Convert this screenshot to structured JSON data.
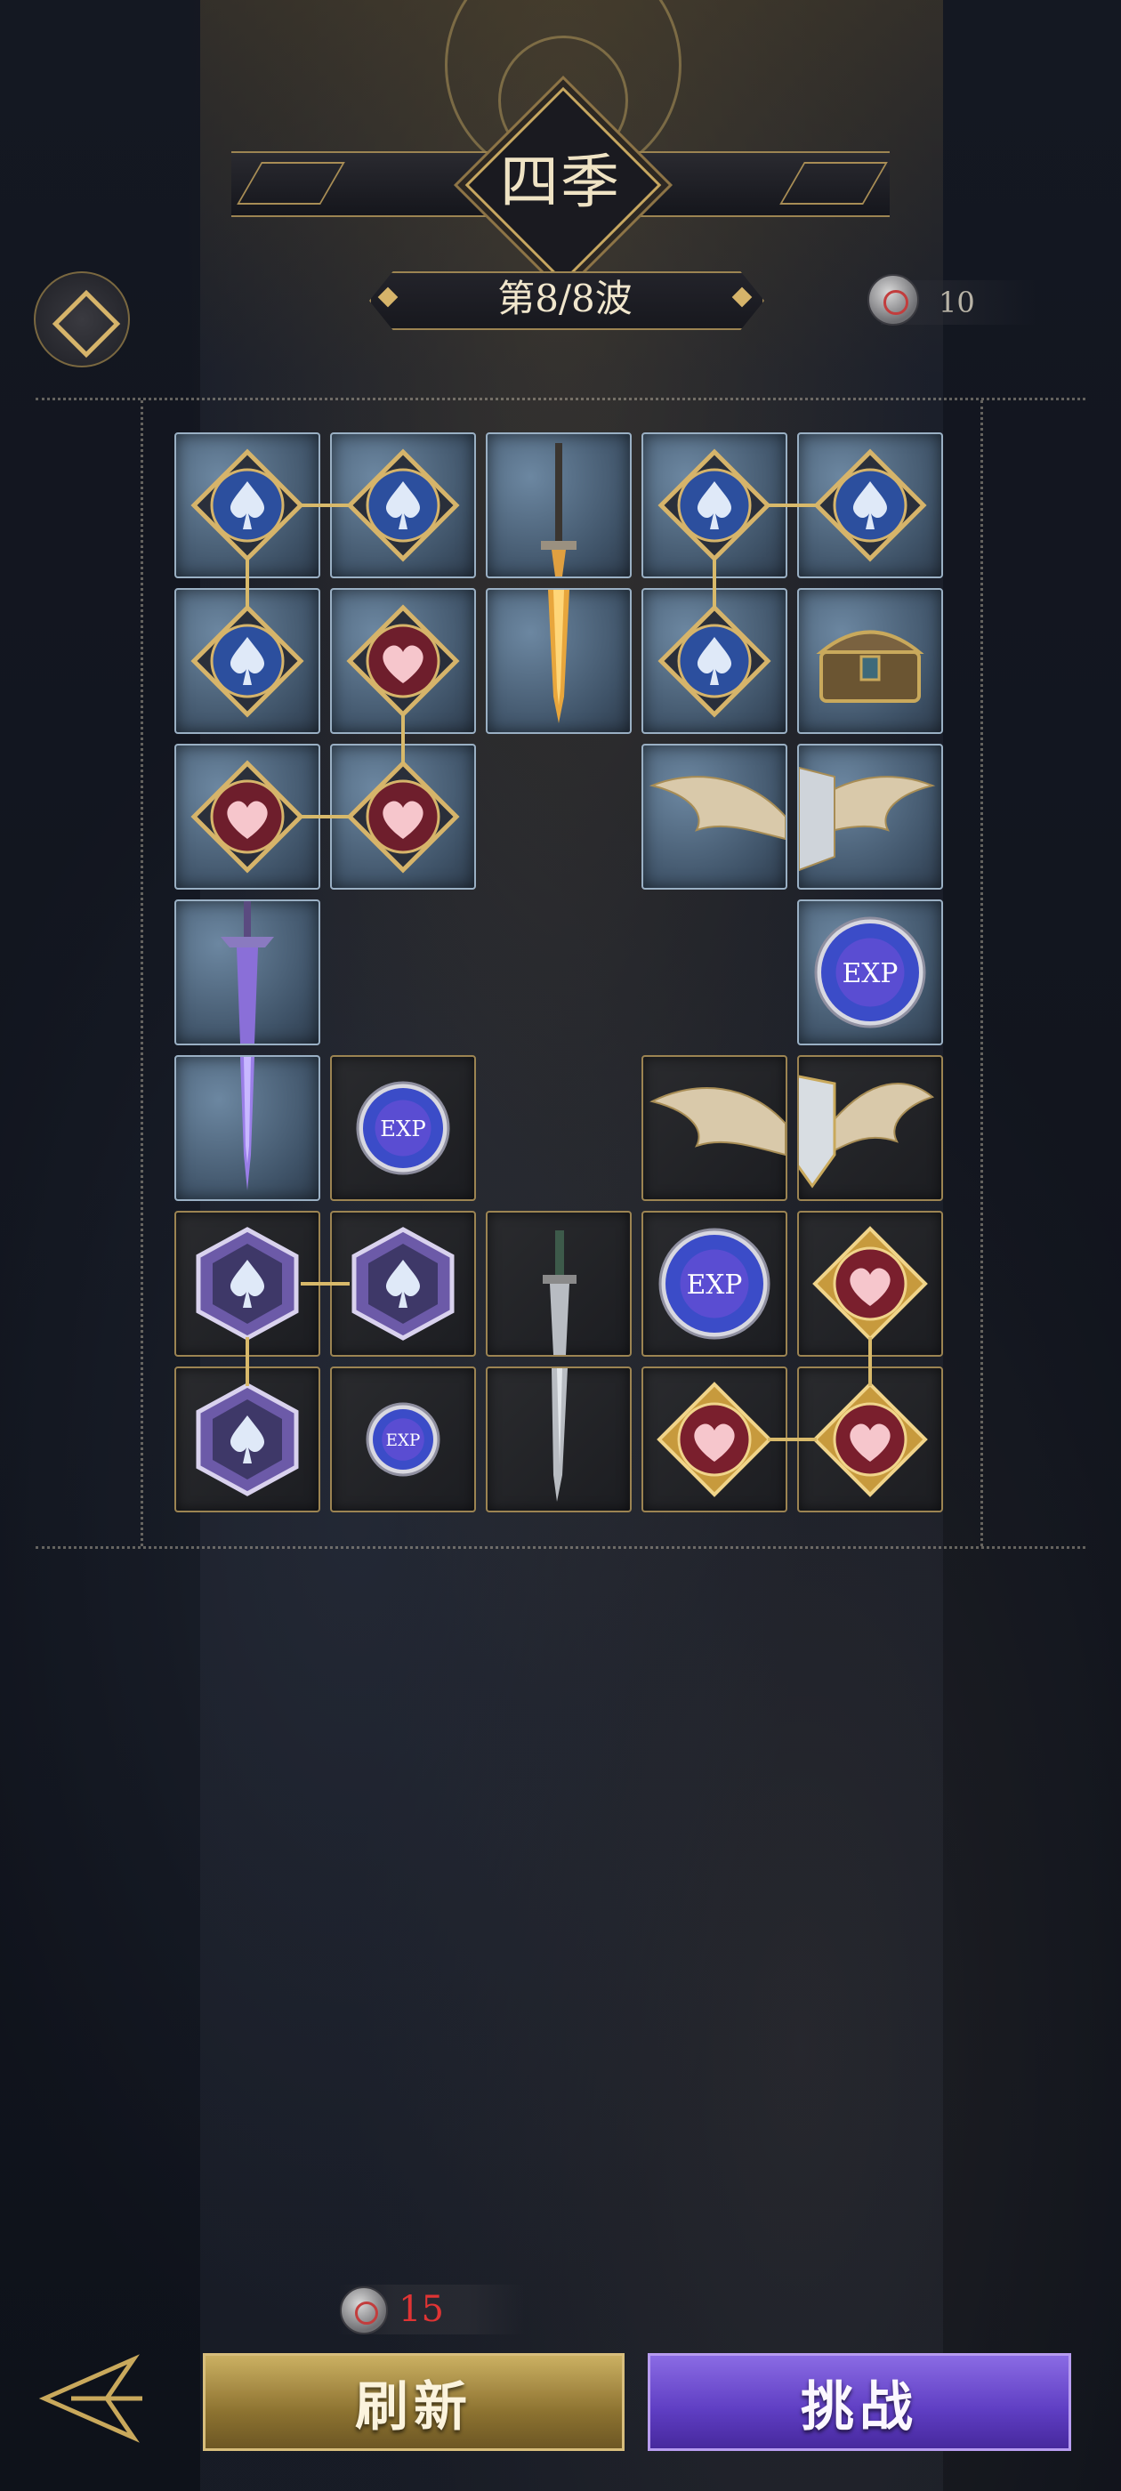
{
  "header": {
    "title": "四季",
    "wave_text": "第8/8波",
    "currency_amount": "10"
  },
  "board": {
    "columns": 5,
    "rows": 7,
    "tiles": [
      {
        "name": "spade-tile",
        "type": "spade",
        "bg": "stone",
        "row": 0,
        "col": 0
      },
      {
        "name": "spade-tile",
        "type": "spade",
        "bg": "stone",
        "row": 0,
        "col": 1
      },
      {
        "name": "sword-tile",
        "type": "gold-dagger",
        "bg": "stone",
        "row": 0,
        "col": 2
      },
      {
        "name": "spade-tile",
        "type": "spade",
        "bg": "stone",
        "row": 0,
        "col": 3
      },
      {
        "name": "spade-tile",
        "type": "spade",
        "bg": "stone",
        "row": 0,
        "col": 4
      },
      {
        "name": "spade-tile",
        "type": "spade",
        "bg": "stone",
        "row": 1,
        "col": 0
      },
      {
        "name": "heart-tile",
        "type": "heart",
        "bg": "stone",
        "row": 1,
        "col": 1
      },
      {
        "name": "sword-tile",
        "type": "gold-dagger-lower",
        "bg": "stone",
        "row": 1,
        "col": 2
      },
      {
        "name": "spade-tile",
        "type": "spade",
        "bg": "stone",
        "row": 1,
        "col": 3
      },
      {
        "name": "treasure-chest-tile",
        "type": "chest",
        "bg": "stone",
        "row": 1,
        "col": 4
      },
      {
        "name": "heart-tile",
        "type": "heart",
        "bg": "stone",
        "row": 2,
        "col": 0
      },
      {
        "name": "heart-tile",
        "type": "heart",
        "bg": "stone",
        "row": 2,
        "col": 1
      },
      {
        "name": "winged-shield-tile",
        "type": "wing-left",
        "bg": "stone",
        "row": 2,
        "col": 3
      },
      {
        "name": "winged-shield-tile",
        "type": "wing-right",
        "bg": "stone",
        "row": 2,
        "col": 4
      },
      {
        "name": "purple-sword-tile",
        "type": "purple-sword",
        "bg": "stone",
        "row": 3,
        "col": 0
      },
      {
        "name": "exp-orb-tile",
        "type": "exp-large",
        "bg": "stone",
        "row": 3,
        "col": 4
      },
      {
        "name": "purple-sword-tile",
        "type": "purple-sword-lower",
        "bg": "stone",
        "row": 4,
        "col": 0
      },
      {
        "name": "exp-orb-tile",
        "type": "exp-medium",
        "bg": "dark",
        "row": 4,
        "col": 1
      },
      {
        "name": "winged-shield-tile",
        "type": "shield-left",
        "bg": "dark",
        "row": 4,
        "col": 3
      },
      {
        "name": "winged-shield-tile",
        "type": "shield-right",
        "bg": "dark",
        "row": 4,
        "col": 4
      },
      {
        "name": "hex-spade-tile",
        "type": "hex-spade",
        "bg": "dark",
        "row": 5,
        "col": 0
      },
      {
        "name": "hex-spade-tile",
        "type": "hex-spade",
        "bg": "dark",
        "row": 5,
        "col": 1
      },
      {
        "name": "dagger-tile",
        "type": "steel-dagger",
        "bg": "dark",
        "row": 5,
        "col": 2
      },
      {
        "name": "exp-orb-tile",
        "type": "exp-large",
        "bg": "dark",
        "row": 5,
        "col": 3
      },
      {
        "name": "gold-heart-tile",
        "type": "gold-heart",
        "bg": "dark",
        "row": 5,
        "col": 4
      },
      {
        "name": "hex-spade-tile",
        "type": "hex-spade",
        "bg": "dark",
        "row": 6,
        "col": 0
      },
      {
        "name": "exp-orb-tile",
        "type": "exp-small",
        "bg": "dark",
        "row": 6,
        "col": 1
      },
      {
        "name": "dagger-tile",
        "type": "steel-dagger-lower",
        "bg": "dark",
        "row": 6,
        "col": 2
      },
      {
        "name": "gold-heart-tile",
        "type": "gold-heart",
        "bg": "dark",
        "row": 6,
        "col": 3
      },
      {
        "name": "gold-heart-tile",
        "type": "gold-heart",
        "bg": "dark",
        "row": 6,
        "col": 4
      }
    ],
    "exp_label": "EXP"
  },
  "footer": {
    "refresh_cost": "15",
    "refresh_label": "刷新",
    "challenge_label": "挑战"
  },
  "colors": {
    "gold": "#d6b46a",
    "refresh_button": "#a88c44",
    "challenge_button": "#6a4ad0",
    "cost_red": "#e03434"
  }
}
